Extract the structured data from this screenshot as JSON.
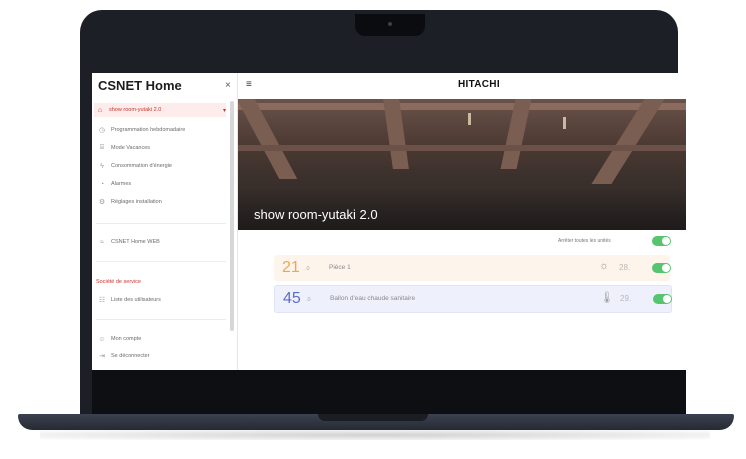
{
  "colors": {
    "accent_red": "#c0392b",
    "toggle_on": "#57c46f",
    "card1_bg": "#fdf4ec",
    "card2_bg": "#eef0fb",
    "temp1": "#f2a74b",
    "temp2": "#5b6fc9"
  },
  "sidebar": {
    "app_title": "CSNET Home",
    "close_icon": "×",
    "items": [
      {
        "icon": "home-icon",
        "label": "show room-yutaki 2.0",
        "active": true
      },
      {
        "icon": "clock-icon",
        "label": "Programmation hebdomadaire"
      },
      {
        "icon": "suitcase-icon",
        "label": "Mode Vacances"
      },
      {
        "icon": "energy-icon",
        "label": "Consommation d'énergie"
      },
      {
        "icon": "alarm-icon",
        "label": "Alarmes"
      },
      {
        "icon": "gear-icon",
        "label": "Réglages installation"
      },
      {
        "icon": "wifi-icon",
        "label": "CSNET Home WEB"
      }
    ],
    "section_service": "Société de service",
    "service_item": {
      "icon": "users-icon",
      "label": "Liste des utilisateurs"
    },
    "account_items": [
      {
        "icon": "user-icon",
        "label": "Mon compte"
      },
      {
        "icon": "logout-icon",
        "label": "Se déconnecter"
      }
    ]
  },
  "header": {
    "menu_icon": "≡",
    "brand": "HITACHI"
  },
  "hero": {
    "title": "show room-yutaki 2.0"
  },
  "controls": {
    "stop_all_label": "Arrêter toutes les unités",
    "stop_all_on": true
  },
  "rooms": [
    {
      "temp": "21",
      "unit": ".0",
      "name": "Pièce 1",
      "icon": "sun-icon",
      "setpoint": "28.",
      "on": true
    },
    {
      "temp": "45",
      "unit": ".0",
      "name": "Ballon d'eau chaude sanitaire",
      "icon": "thermometer-icon",
      "setpoint": "29.",
      "on": true
    }
  ]
}
